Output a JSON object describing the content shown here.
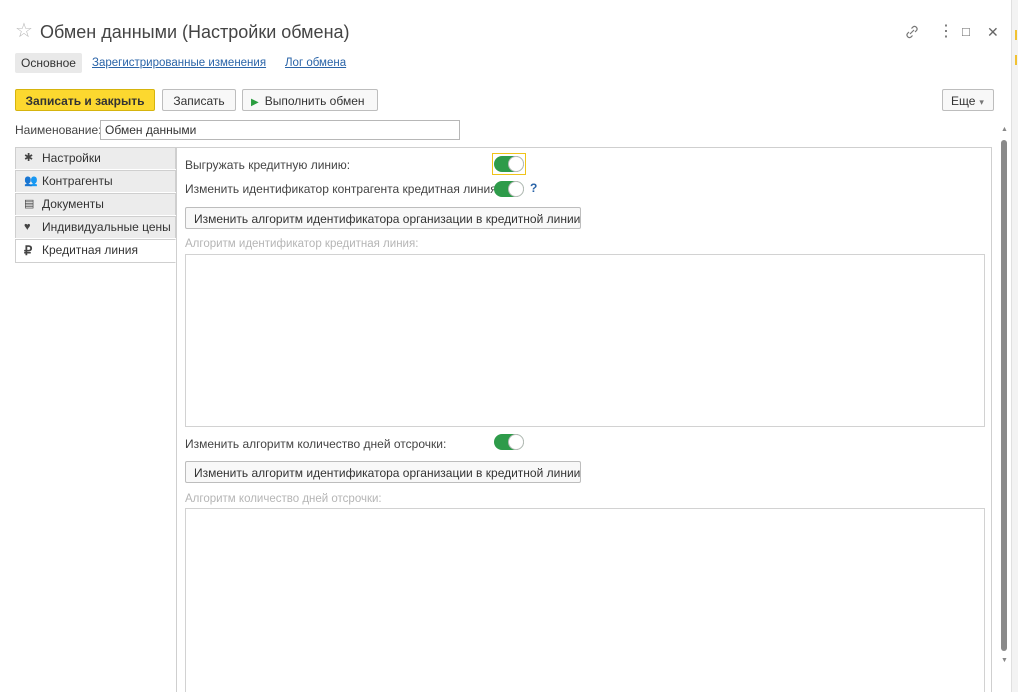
{
  "window": {
    "title": "Обмен данными (Настройки обмена)",
    "star_icon": "☆",
    "link_icon": "🔗",
    "more_icon": "⋮",
    "maximize_icon": "□",
    "close_icon": "✕"
  },
  "tabs": {
    "main": "Основное",
    "links": [
      "Зарегистрированные изменения",
      "Лог обмена"
    ]
  },
  "toolbar": {
    "save_close": "Записать и закрыть",
    "save": "Записать",
    "run_exchange": "Выполнить обмен",
    "more": "Еще"
  },
  "name_field": {
    "label": "Наименование:",
    "value": "Обмен данными"
  },
  "side_tabs": [
    {
      "label": "Настройки",
      "icon": "✱"
    },
    {
      "label": "Контрагенты",
      "icon": "👥"
    },
    {
      "label": "Документы",
      "icon": "▤"
    },
    {
      "label": "Индивидуальные цены",
      "icon": "♥"
    },
    {
      "label": "Кредитная линия",
      "icon": "₽"
    }
  ],
  "credit_line": {
    "export_label": "Выгружать кредитную линию:",
    "export_on": true,
    "change_id_label": "Изменить идентификатор контрагента кредитная линия:",
    "change_id_on": true,
    "help_mark": "?",
    "change_algo_button_1": "Изменить алгоритм идентификатора организации в кредитной линии",
    "algo_id_placeholder": "Алгоритм идентификатор кредитная линия:",
    "change_days_label": "Изменить алгоритм количество дней отсрочки:",
    "change_days_on": true,
    "change_algo_button_2": "Изменить алгоритм идентификатора организации в кредитной линии",
    "algo_days_placeholder": "Алгоритм количество дней отсрочки:"
  },
  "colors": {
    "accent_yellow": "#fcd82f",
    "toggle_green": "#2e9b4a",
    "link_blue": "#2a64a8"
  }
}
